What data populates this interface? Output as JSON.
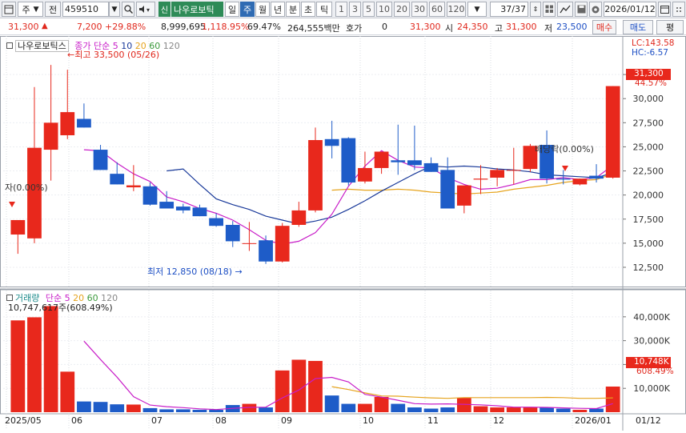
{
  "toolbar": {
    "period_left": "주",
    "prev_label": "전",
    "code": "459510",
    "stock_badge": "신",
    "stock_name": "나우로보틱",
    "period_tabs": [
      "일",
      "주",
      "월",
      "년",
      "분",
      "초",
      "틱"
    ],
    "active_period": "주",
    "intervals": [
      "1",
      "3",
      "5",
      "10",
      "20",
      "30",
      "60",
      "120"
    ],
    "page_counter": "37/37",
    "date": "2026/01/12"
  },
  "info": {
    "price": "31,300",
    "change": "7,200",
    "change_pct": "+29.88%",
    "volume": "8,999,695",
    "volume_pct": "1,118.95%",
    "ratio": "69.47%",
    "amount": "264,555백만",
    "hoga_label": "호가",
    "hoga_value": "0",
    "ask_price": "31,300",
    "open_label": "시",
    "open_value": "24,350",
    "high_label": "고",
    "high_value": "31,300",
    "low_label": "저",
    "low_value": "23,500",
    "buy_label": "매수",
    "sell_label": "매도",
    "flat_label": "평"
  },
  "price_panel": {
    "title_name": "나우로보틱스",
    "legend_prefix": "종가 단순",
    "ma_labels": [
      "5",
      "10",
      "20",
      "60",
      "120"
    ],
    "lc_label": "LC:143.58",
    "hc_label": "HC:-6.57",
    "current_price_tag": "31,300",
    "current_pct_tag": "44.57%",
    "high_annotation": "최고 33,500 (05/26)",
    "low_annotation": "최저 12,850 (08/18)",
    "left_annotation": "자(0.00%)",
    "dividend_annotation": "배당락(0.00%)"
  },
  "volume_panel": {
    "title": "거래량",
    "legend_prefix": "단순",
    "ma_labels": [
      "5",
      "20",
      "60",
      "120"
    ],
    "volume_readout": "10,747,617주(608.49%)",
    "current_tag": "10,748K",
    "current_pct": "608.49%"
  },
  "x_axis": {
    "labels": [
      "2025/05",
      "06",
      "07",
      "08",
      "09",
      "10",
      "11",
      "12",
      "2026/01"
    ],
    "right_label": "01/12"
  },
  "chart_data": {
    "type": "candlestick",
    "ylim": [
      11500,
      35500
    ],
    "yticks": [
      "32,500",
      "30,000",
      "27,500",
      "25,000",
      "22,500",
      "20,000",
      "17,500",
      "15,000",
      "12,500"
    ],
    "candles": [
      {
        "o": 15900,
        "h": 16400,
        "l": 13900,
        "c": 17400
      },
      {
        "o": 15500,
        "h": 31200,
        "l": 15000,
        "c": 24900
      },
      {
        "o": 24700,
        "h": 33500,
        "l": 21500,
        "c": 27500
      },
      {
        "o": 26200,
        "h": 33000,
        "l": 25800,
        "c": 28600
      },
      {
        "o": 27900,
        "h": 29500,
        "l": 27000,
        "c": 27000
      },
      {
        "o": 24700,
        "h": 25200,
        "l": 22600,
        "c": 22600
      },
      {
        "o": 22200,
        "h": 23400,
        "l": 21100,
        "c": 21100
      },
      {
        "o": 20800,
        "h": 23100,
        "l": 20400,
        "c": 21000
      },
      {
        "o": 20900,
        "h": 21300,
        "l": 18900,
        "c": 19000
      },
      {
        "o": 19300,
        "h": 20400,
        "l": 18600,
        "c": 18600
      },
      {
        "o": 18800,
        "h": 19100,
        "l": 18100,
        "c": 18400
      },
      {
        "o": 18700,
        "h": 19000,
        "l": 17800,
        "c": 17800
      },
      {
        "o": 17600,
        "h": 18100,
        "l": 16700,
        "c": 16800
      },
      {
        "o": 16900,
        "h": 17300,
        "l": 14600,
        "c": 15200
      },
      {
        "o": 15000,
        "h": 17200,
        "l": 14200,
        "c": 15000
      },
      {
        "o": 15300,
        "h": 15800,
        "l": 12850,
        "c": 13100
      },
      {
        "o": 13100,
        "h": 17100,
        "l": 13000,
        "c": 16800
      },
      {
        "o": 16900,
        "h": 19300,
        "l": 16700,
        "c": 18400
      },
      {
        "o": 18400,
        "h": 27000,
        "l": 18200,
        "c": 25700
      },
      {
        "o": 25800,
        "h": 27700,
        "l": 23800,
        "c": 25100
      },
      {
        "o": 25900,
        "h": 26000,
        "l": 21000,
        "c": 21300
      },
      {
        "o": 21400,
        "h": 24500,
        "l": 21200,
        "c": 22800
      },
      {
        "o": 22800,
        "h": 24500,
        "l": 22200,
        "c": 24500
      },
      {
        "o": 23600,
        "h": 27300,
        "l": 22100,
        "c": 23400
      },
      {
        "o": 23600,
        "h": 27200,
        "l": 22600,
        "c": 23100
      },
      {
        "o": 23300,
        "h": 23900,
        "l": 22400,
        "c": 22400
      },
      {
        "o": 22600,
        "h": 23900,
        "l": 18600,
        "c": 18600
      },
      {
        "o": 18900,
        "h": 21000,
        "l": 18100,
        "c": 21000
      },
      {
        "o": 21600,
        "h": 23100,
        "l": 20100,
        "c": 21700
      },
      {
        "o": 21800,
        "h": 22800,
        "l": 20900,
        "c": 22600
      },
      {
        "o": 22600,
        "h": 24900,
        "l": 21100,
        "c": 22600
      },
      {
        "o": 22700,
        "h": 25300,
        "l": 22400,
        "c": 25100
      },
      {
        "o": 25200,
        "h": 26700,
        "l": 21200,
        "c": 21700
      },
      {
        "o": 21700,
        "h": 22600,
        "l": 21100,
        "c": 21600
      },
      {
        "o": 21100,
        "h": 21700,
        "l": 21000,
        "c": 21700
      },
      {
        "o": 22000,
        "h": 23200,
        "l": 21300,
        "c": 21700
      },
      {
        "o": 21800,
        "h": 31300,
        "l": 21700,
        "c": 31300
      }
    ],
    "ma5": [
      null,
      null,
      null,
      null,
      24700,
      24600,
      23300,
      22200,
      21400,
      19800,
      19300,
      18600,
      18100,
      17400,
      16400,
      15300,
      14900,
      15200,
      16100,
      18000,
      20900,
      23000,
      24600,
      23600,
      22900,
      22800,
      21800,
      21100,
      20600,
      20700,
      21100,
      21600,
      21600,
      21800,
      21600,
      21800,
      23100
    ],
    "ma10": [
      null,
      null,
      null,
      null,
      null,
      null,
      null,
      null,
      null,
      22500,
      22700,
      21100,
      19600,
      19000,
      18500,
      17800,
      17400,
      17000,
      17300,
      17700,
      18500,
      19400,
      20400,
      21300,
      22200,
      23000,
      22900,
      23000,
      22900,
      22700,
      22600,
      22400,
      22100,
      22000,
      21900,
      21800,
      22300
    ],
    "ma20": [
      null,
      null,
      null,
      null,
      null,
      null,
      null,
      null,
      null,
      null,
      null,
      null,
      null,
      null,
      null,
      null,
      null,
      null,
      null,
      20500,
      20600,
      20500,
      20500,
      20600,
      20500,
      20300,
      20200,
      20100,
      20200,
      20300,
      20600,
      20800,
      21000,
      21300,
      21500,
      21600,
      22200
    ],
    "volume": {
      "ylim": [
        0,
        48000
      ],
      "yticks": [
        "40,000K",
        "30,000K",
        "20,000K",
        "10,000K"
      ],
      "bars": [
        38500,
        39800,
        44500,
        17000,
        4500,
        4300,
        3300,
        3200,
        1700,
        1200,
        1200,
        1000,
        1000,
        3000,
        3500,
        2000,
        17500,
        22000,
        21500,
        7000,
        3500,
        3500,
        6400,
        3500,
        2000,
        1500,
        2000,
        6000,
        2500,
        2000,
        2000,
        2000,
        2000,
        1500,
        1000,
        1500,
        10748
      ],
      "ma5": [
        null,
        null,
        null,
        null,
        29800,
        22100,
        14700,
        6500,
        3000,
        2300,
        1900,
        1400,
        1100,
        1600,
        2000,
        2100,
        6000,
        9300,
        14100,
        14600,
        12700,
        7500,
        6300,
        5000,
        3600,
        3400,
        3500,
        3300,
        3100,
        2700,
        2100,
        2100,
        2000,
        1800,
        1600,
        1500,
        3600
      ],
      "ma20": [
        null,
        null,
        null,
        null,
        null,
        null,
        null,
        null,
        null,
        null,
        null,
        null,
        null,
        null,
        null,
        null,
        null,
        null,
        null,
        10700,
        9500,
        8100,
        6800,
        6700,
        6300,
        6000,
        5800,
        6100,
        6100,
        6100,
        6100,
        6100,
        6200,
        6100,
        5800,
        5800,
        6000
      ]
    },
    "up_color": "#e8281c",
    "down_color": "#1e5cc8",
    "ma5_color": "#c81ec8",
    "ma10_color": "#1a3a9a",
    "ma20_color": "#e6a41e",
    "ma60_color": "#3c9a3c",
    "ma120_color": "#888888"
  }
}
